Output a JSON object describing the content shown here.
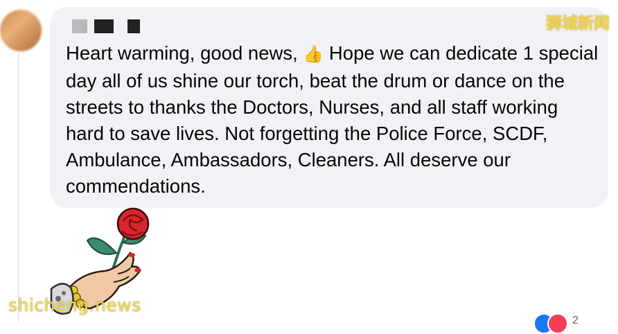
{
  "comment": {
    "author_name": "▇▇ ▇",
    "text_before_emoji": "Heart warming, good news, ",
    "emoji": "👍",
    "text_after_emoji": " Hope we can dedicate 1 special day all of us shine our torch, beat the drum or dance on the streets to thanks the Doctors, Nurses, and all staff working hard to save lives. Not forgetting the Police Force, SCDF, Ambulance, Ambassadors, Cleaners. All deserve our commendations."
  },
  "sticker": {
    "name": "hand-holding-rose"
  },
  "reactions": {
    "icons": [
      "like-icon",
      "love-icon"
    ],
    "count": "2"
  },
  "watermarks": {
    "top_right": "狮城新闻",
    "bottom_left": "shicheng.news"
  },
  "colors": {
    "bubble": "#f0f2f5",
    "text": "#050505",
    "watermark": "#f5d547"
  }
}
